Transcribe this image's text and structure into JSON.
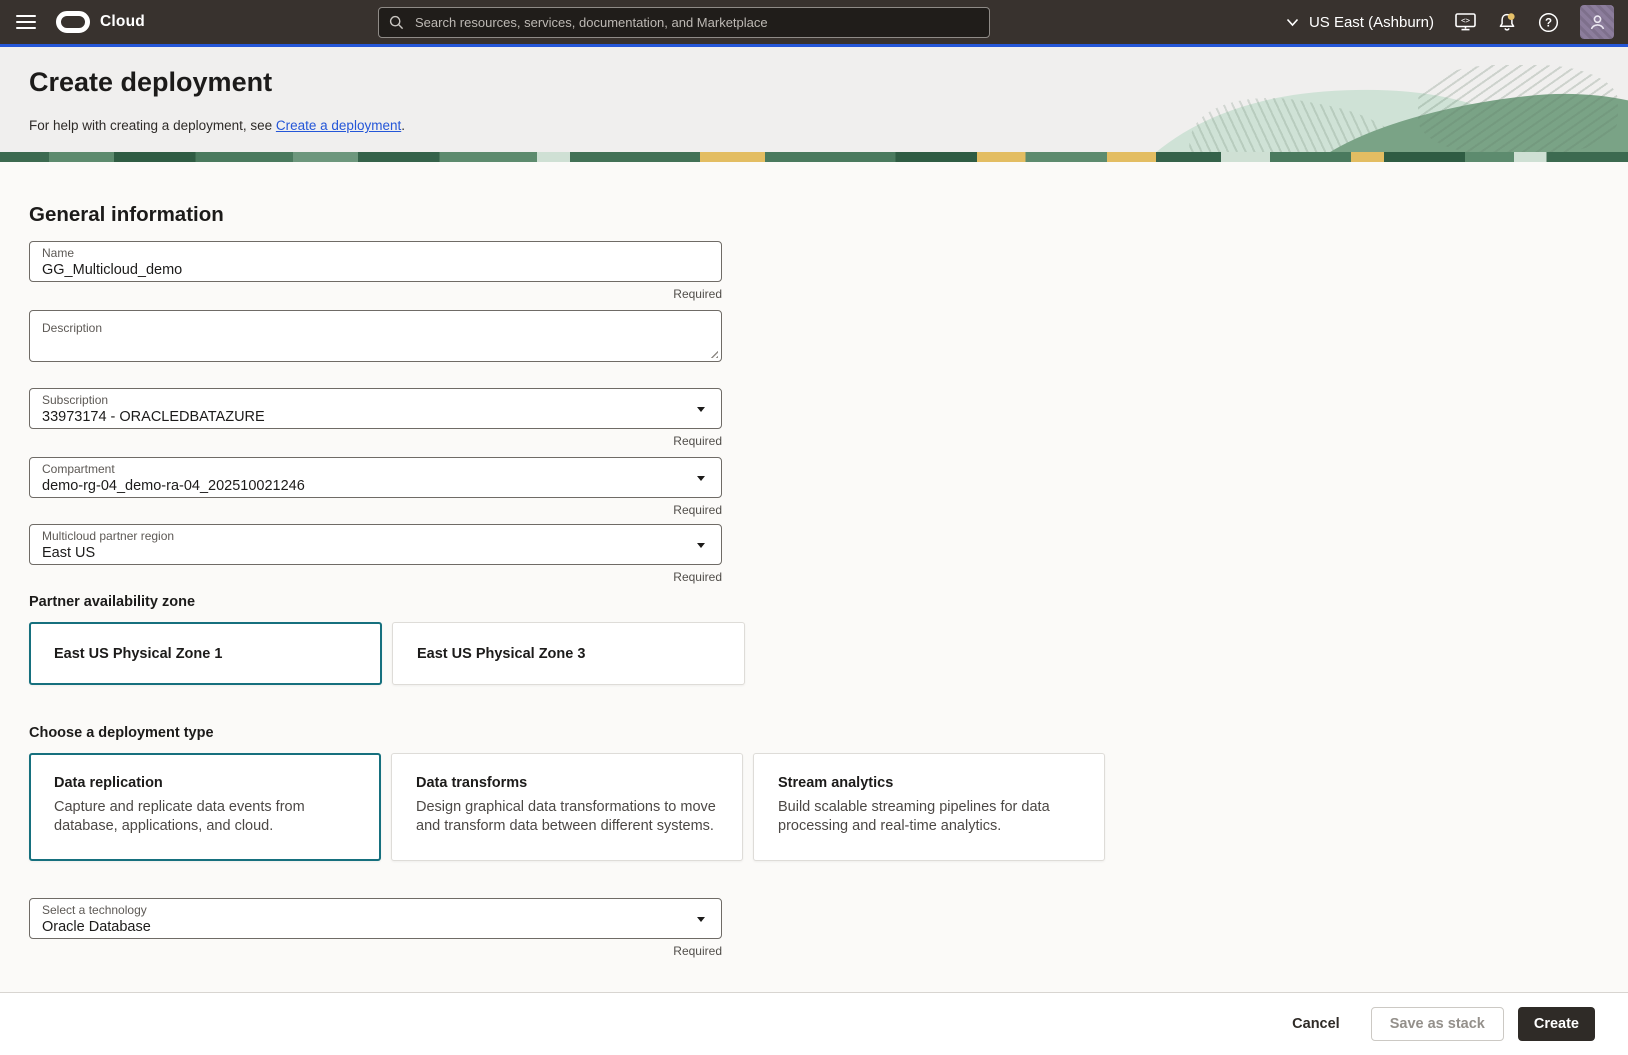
{
  "topbar": {
    "brand": "Cloud",
    "search_placeholder": "Search resources, services, documentation, and Marketplace",
    "region": "US East (Ashburn)"
  },
  "header": {
    "title": "Create deployment",
    "help_prefix": "For help with creating a deployment, see ",
    "help_link": "Create a deployment",
    "help_suffix": "."
  },
  "form": {
    "section_title": "General information",
    "required_label": "Required",
    "name": {
      "label": "Name",
      "value": "GG_Multicloud_demo"
    },
    "description": {
      "label": "Description",
      "value": ""
    },
    "subscription": {
      "label": "Subscription",
      "value": "33973174 - ORACLEDBATAZURE"
    },
    "compartment": {
      "label": "Compartment",
      "value": "demo-rg-04_demo-ra-04_202510021246"
    },
    "partner_region": {
      "label": "Multicloud partner region",
      "value": "East US"
    },
    "zone_section": {
      "label": "Partner availability zone",
      "options": [
        {
          "label": "East US Physical Zone 1",
          "selected": true
        },
        {
          "label": "East US Physical Zone 3",
          "selected": false
        }
      ]
    },
    "deployment_section": {
      "label": "Choose a deployment type",
      "options": [
        {
          "title": "Data replication",
          "description": "Capture and replicate data events from database, applications, and cloud.",
          "selected": true
        },
        {
          "title": "Data transforms",
          "description": "Design graphical data transformations to move and transform data between different systems.",
          "selected": false
        },
        {
          "title": "Stream analytics",
          "description": "Build scalable streaming pipelines for data processing and real-time analytics.",
          "selected": false
        }
      ]
    },
    "technology": {
      "label": "Select a technology",
      "value": "Oracle Database"
    }
  },
  "footer": {
    "cancel": "Cancel",
    "save_as_stack": "Save as stack",
    "create": "Create"
  },
  "icons": {
    "menu": "hamburger-icon",
    "brand": "oracle-logo",
    "search": "search-icon",
    "region": "chevron-down-icon",
    "cloud_shell": "terminal-monitor-icon",
    "notifications": "bell-icon",
    "help": "help-icon",
    "profile": "user-avatar-icon",
    "dropdown": "caret-down-icon"
  },
  "colors": {
    "topbar_bg": "#38322e",
    "accent_blue": "#2456d8",
    "selected_teal": "#16707e",
    "header_bg": "#f0efee",
    "content_bg": "#fbfaf8",
    "badge_yellow": "#e6c169",
    "avatar_purple": "#8c7d9c",
    "banner_green_dark": "#2f5c43",
    "banner_green": "#5d8b6e",
    "banner_yellow": "#e3bd62",
    "banner_mint": "#cfe0d4"
  }
}
